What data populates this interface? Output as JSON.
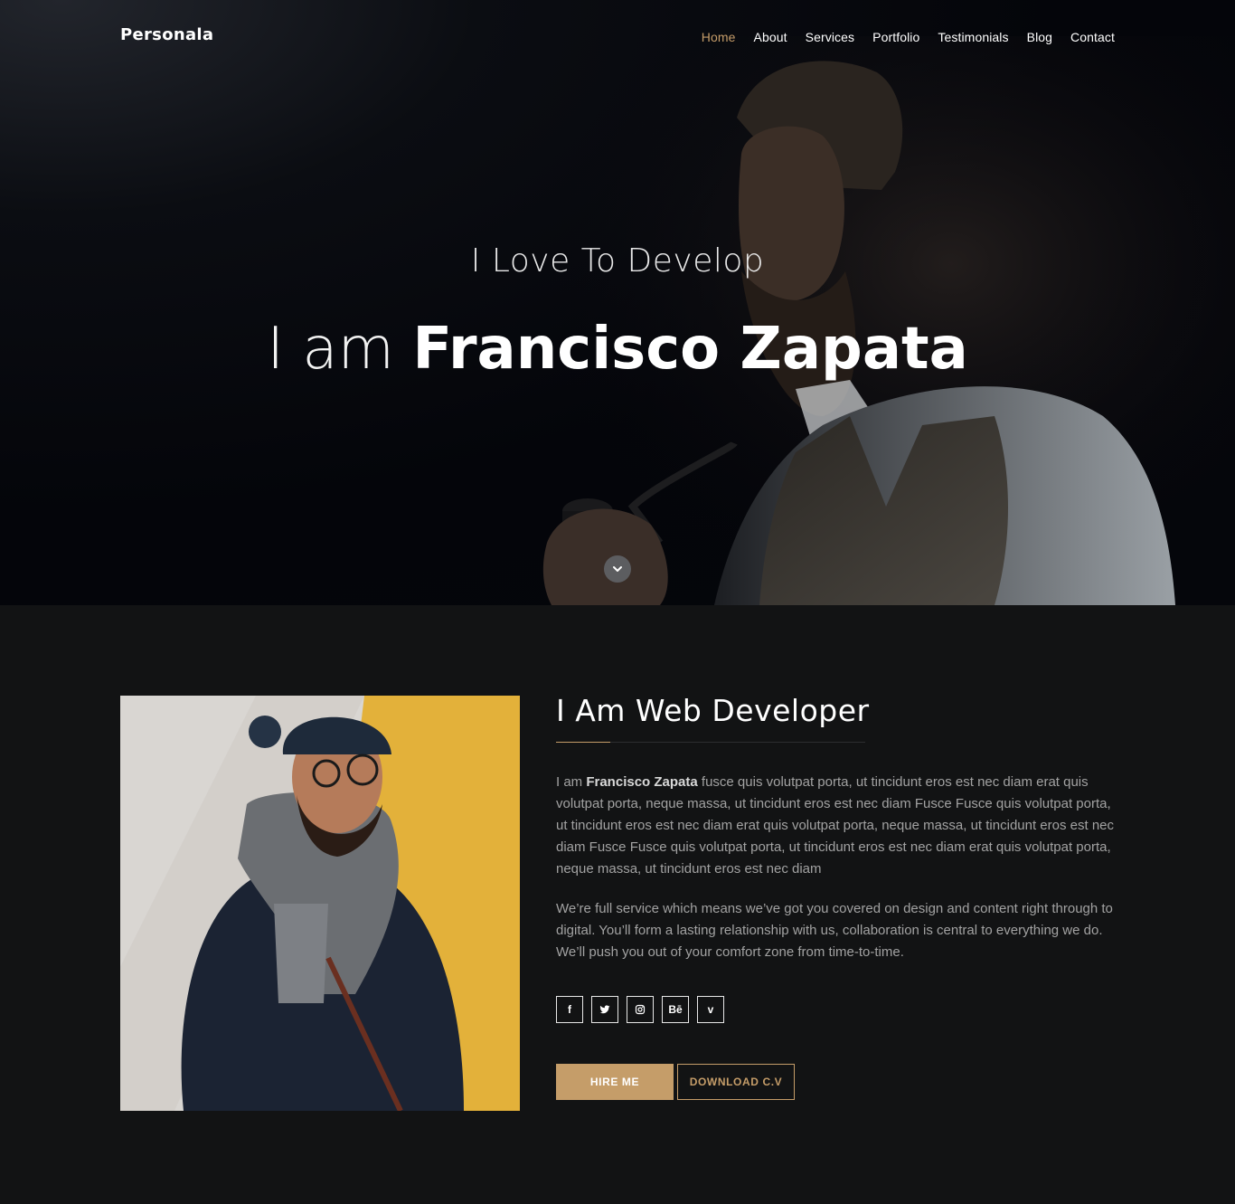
{
  "header": {
    "brand": "Personala",
    "nav": [
      "Home",
      "About",
      "Services",
      "Portfolio",
      "Testimonials",
      "Blog",
      "Contact"
    ],
    "active_nav": "Home"
  },
  "hero": {
    "subtitle": "I Love To Develop",
    "title_prefix": "I am",
    "title_name": "Francisco Zapata",
    "scroll_icon": "chevron-down-icon"
  },
  "about": {
    "heading": "I Am Web Developer",
    "para1_intro": "I am ",
    "para1_name": "Francisco Zapata",
    "para1_rest": " fusce quis volutpat porta, ut tincidunt eros est nec diam erat quis volutpat porta, neque massa, ut tincidunt eros est nec diam Fusce Fusce quis volutpat porta, ut tincidunt eros est nec diam erat quis volutpat porta, neque massa, ut tincidunt eros est nec diam Fusce Fusce quis volutpat porta, ut tincidunt eros est nec diam erat quis volutpat porta, neque massa, ut tincidunt eros est nec diam",
    "para2": "We’re full service which means we’ve got you covered on design and content right through to digital. You’ll form a lasting relationship with us, collaboration is central to everything we do. We’ll push you out of your comfort zone from time-to-time.",
    "socials": [
      {
        "icon": "facebook-icon",
        "glyph": "f"
      },
      {
        "icon": "twitter-icon",
        "glyph": ""
      },
      {
        "icon": "instagram-icon",
        "glyph": ""
      },
      {
        "icon": "behance-icon",
        "glyph": "Bē"
      },
      {
        "icon": "vimeo-icon",
        "glyph": "v"
      }
    ],
    "hire_label": "HIRE ME",
    "download_label": "DOWNLOAD C.V"
  },
  "colors": {
    "accent": "#c59d69",
    "background": "#121314",
    "hero_background": "#05060b"
  }
}
